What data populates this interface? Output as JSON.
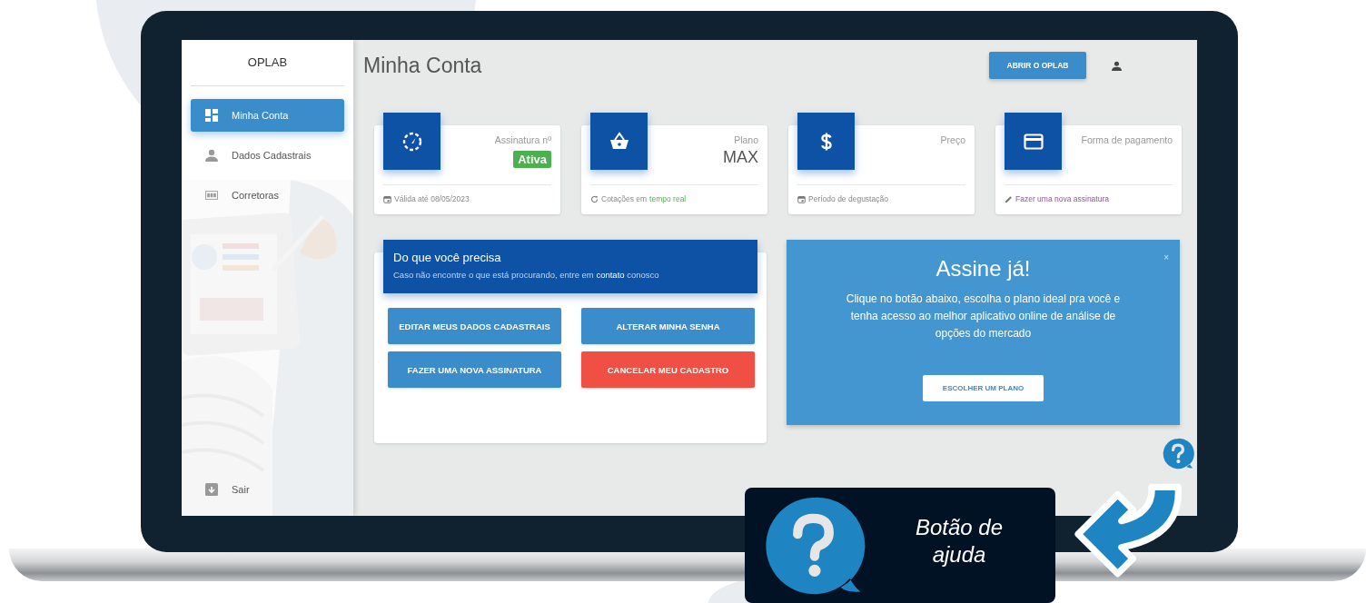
{
  "sidebar": {
    "brand": "OPLAB",
    "items": [
      {
        "label": "Minha Conta",
        "selected": true
      },
      {
        "label": "Dados Cadastrais",
        "selected": false
      },
      {
        "label": "Corretoras",
        "selected": false
      }
    ],
    "logout": {
      "label": "Sair"
    }
  },
  "header": {
    "title": "Minha Conta",
    "button": "ABRIR O OPLAB"
  },
  "cards": [
    {
      "label": "Assinatura nº",
      "badge": "Ativa",
      "footer": {
        "kind": "info",
        "text": "Válida até 08/05/2023"
      }
    },
    {
      "label": "Plano",
      "value": "MAX",
      "footer": {
        "kind": "info",
        "text": "Cotações em",
        "highlight": "tempo real"
      }
    },
    {
      "label": "Preço",
      "footer": {
        "kind": "info",
        "text": "Período de degustação"
      }
    },
    {
      "label": "Forma de pagamento",
      "footer": {
        "kind": "link",
        "text": "Fazer uma nova assinatura"
      }
    }
  ],
  "help_panel": {
    "title": "Do que você precisa",
    "subtitle": "Caso não encontre o que está procurando, entre em",
    "link": "contato",
    "subtitle_end": "conosco",
    "buttons": [
      {
        "label": "EDITAR MEUS DADOS CADASTRAIS",
        "kind": "primary"
      },
      {
        "label": "ALTERAR MINHA SENHA",
        "kind": "primary"
      },
      {
        "label": "FAZER UMA NOVA ASSINATURA",
        "kind": "primary"
      },
      {
        "label": "CANCELAR MEU CADASTRO",
        "kind": "danger"
      }
    ]
  },
  "promo": {
    "title": "Assine já!",
    "text": "Clique no botão abaixo, escolha o plano ideal pra você e tenha acesso ao melhor aplicativo online de análise de opções do mercado",
    "button": "ESCOLHER UM PLANO",
    "close": "×"
  },
  "callout": {
    "text": "Botão de ajuda"
  }
}
